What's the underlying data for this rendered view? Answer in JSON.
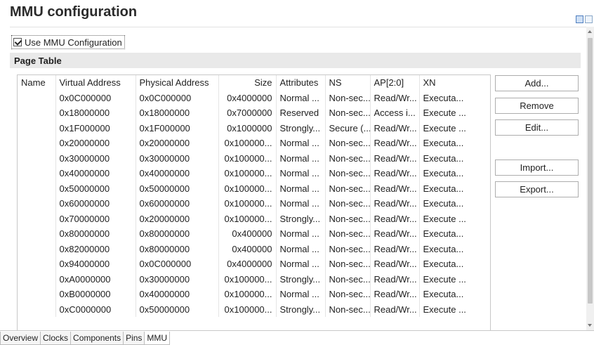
{
  "header": {
    "title": "MMU configuration"
  },
  "options": {
    "use_mmu_label": "Use MMU Configuration",
    "use_mmu_checked": true
  },
  "page_table": {
    "section_title": "Page Table",
    "columns": [
      "Name",
      "Virtual Address",
      "Physical Address",
      "Size",
      "Attributes",
      "NS",
      "AP[2:0]",
      "XN"
    ],
    "rows": [
      [
        "",
        "0x0C000000",
        "0x0C000000",
        "0x4000000",
        "Normal ...",
        "Non-sec...",
        "Read/Wr...",
        "Executa..."
      ],
      [
        "",
        "0x18000000",
        "0x18000000",
        "0x7000000",
        "Reserved",
        "Non-sec...",
        "Access i...",
        "Execute ..."
      ],
      [
        "",
        "0x1F000000",
        "0x1F000000",
        "0x1000000",
        "Strongly...",
        "Secure (...",
        "Read/Wr...",
        "Execute ..."
      ],
      [
        "",
        "0x20000000",
        "0x20000000",
        "0x100000...",
        "Normal ...",
        "Non-sec...",
        "Read/Wr...",
        "Executa..."
      ],
      [
        "",
        "0x30000000",
        "0x30000000",
        "0x100000...",
        "Normal ...",
        "Non-sec...",
        "Read/Wr...",
        "Executa..."
      ],
      [
        "",
        "0x40000000",
        "0x40000000",
        "0x100000...",
        "Normal ...",
        "Non-sec...",
        "Read/Wr...",
        "Executa..."
      ],
      [
        "",
        "0x50000000",
        "0x50000000",
        "0x100000...",
        "Normal ...",
        "Non-sec...",
        "Read/Wr...",
        "Executa..."
      ],
      [
        "",
        "0x60000000",
        "0x60000000",
        "0x100000...",
        "Normal ...",
        "Non-sec...",
        "Read/Wr...",
        "Executa..."
      ],
      [
        "",
        "0x70000000",
        "0x20000000",
        "0x100000...",
        "Strongly...",
        "Non-sec...",
        "Read/Wr...",
        "Execute ..."
      ],
      [
        "",
        "0x80000000",
        "0x80000000",
        "0x400000",
        "Normal ...",
        "Non-sec...",
        "Read/Wr...",
        "Executa..."
      ],
      [
        "",
        "0x82000000",
        "0x80000000",
        "0x400000",
        "Normal ...",
        "Non-sec...",
        "Read/Wr...",
        "Executa..."
      ],
      [
        "",
        "0x94000000",
        "0x0C000000",
        "0x4000000",
        "Normal ...",
        "Non-sec...",
        "Read/Wr...",
        "Executa..."
      ],
      [
        "",
        "0xA0000000",
        "0x30000000",
        "0x100000...",
        "Strongly...",
        "Non-sec...",
        "Read/Wr...",
        "Execute ..."
      ],
      [
        "",
        "0xB0000000",
        "0x40000000",
        "0x100000...",
        "Normal ...",
        "Non-sec...",
        "Read/Wr...",
        "Executa..."
      ],
      [
        "",
        "0xC0000000",
        "0x50000000",
        "0x100000...",
        "Strongly...",
        "Non-sec...",
        "Read/Wr...",
        "Execute ..."
      ]
    ],
    "buttons": {
      "add": "Add...",
      "remove": "Remove",
      "edit": "Edit...",
      "import": "Import...",
      "export": "Export..."
    }
  },
  "tabs": [
    "Overview",
    "Clocks",
    "Components",
    "Pins",
    "MMU"
  ],
  "active_tab": "MMU",
  "icons": [
    "editor-icon",
    "settings-icon"
  ]
}
